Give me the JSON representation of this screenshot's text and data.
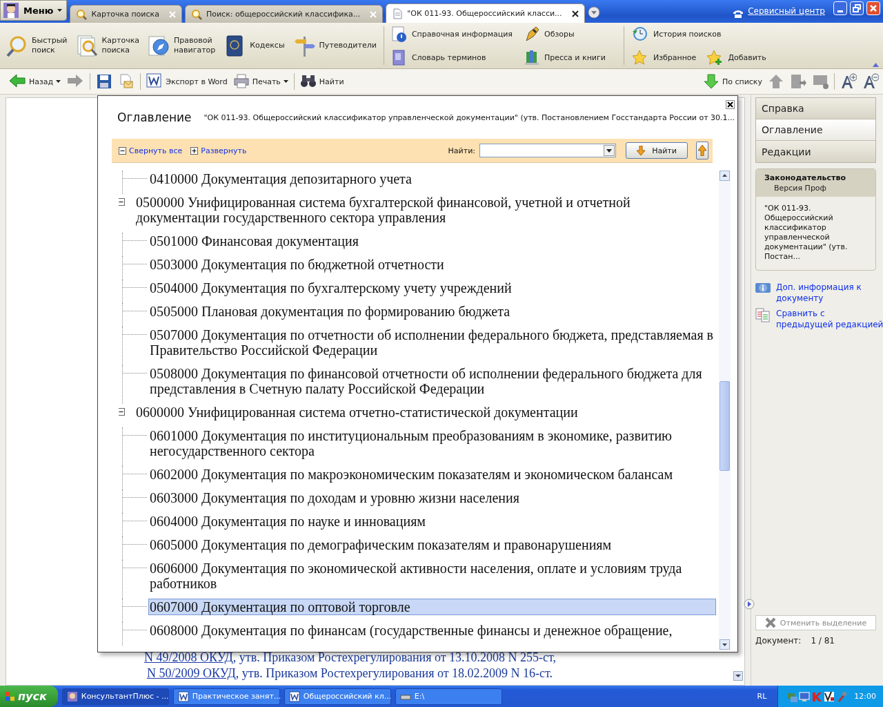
{
  "app": {
    "menu_label": "Меню",
    "service_link": "Сервисный центр"
  },
  "tabs": [
    {
      "label": "Карточка поиска",
      "selected": false
    },
    {
      "label": "Поиск: общероссийский классифика...",
      "selected": false
    },
    {
      "label": "\"ОК 011-93. Общероссийский класси...",
      "selected": true
    }
  ],
  "ribbon": {
    "large": [
      {
        "lines": [
          "Быстрый",
          "поиск"
        ]
      },
      {
        "lines": [
          "Карточка",
          "поиска"
        ]
      },
      {
        "lines": [
          "Правовой",
          "навигатор"
        ]
      },
      {
        "lines": [
          "Кодексы"
        ]
      },
      {
        "lines": [
          "Путеводители"
        ]
      }
    ],
    "reference": [
      [
        "Справочная информация",
        "Словарь терминов"
      ],
      [
        "Обзоры",
        "Пресса и книги"
      ]
    ],
    "history": [
      [
        "История поисков"
      ],
      [
        "Избранное",
        "Добавить"
      ]
    ]
  },
  "toolbar": {
    "left": [
      {
        "label": "Назад",
        "dropdown": true
      },
      {
        "label": "Экспорт в Word",
        "dropdown": false
      },
      {
        "label": "Печать",
        "dropdown": true
      },
      {
        "label": "Найти",
        "dropdown": false
      }
    ],
    "right": [
      {
        "label": "По списку"
      }
    ]
  },
  "document": {
    "lines": [
      {
        "link": "N 49/2008 ОКУД",
        "text": ", утв. Приказом Ростехрегулирования от 13.10.2008 N 255-ст,"
      },
      {
        "link": "N 50/2009 ОКУД",
        "text": ", утв. Приказом Ростехрегулирования от 18.02.2009 N 16-ст."
      }
    ]
  },
  "dialog": {
    "title": "Оглавление",
    "subtitle": "\"ОК 011-93. Общероссийский классификатор управленческой документации\" (утв. Постановлением Госстандарта России от 30.1...",
    "collapse_all": "Свернуть все",
    "expand_all": "Развернуть",
    "find_label": "Найти:",
    "find_button": "Найти",
    "tree": [
      {
        "kind": "leaf",
        "text": "0410000 Документация депозитарного учета",
        "selected": false
      },
      {
        "kind": "group",
        "text": "0500000 Унифицированная система бухгалтерской финансовой, учетной и отчетной документации государственного сектора управления",
        "expanded": true,
        "selected": false,
        "children": [
          {
            "kind": "leaf",
            "text": "0501000 Финансовая документация",
            "selected": false
          },
          {
            "kind": "leaf",
            "text": "0503000 Документация по бюджетной отчетности",
            "selected": false
          },
          {
            "kind": "leaf",
            "text": "0504000 Документация по бухгалтерскому учету учреждений",
            "selected": false
          },
          {
            "kind": "leaf",
            "text": "0505000 Плановая документация по формированию бюджета",
            "selected": false
          },
          {
            "kind": "leaf",
            "text": "0507000 Документация по отчетности об исполнении федерального бюджета, представляемая в Правительство Российской Федерации",
            "selected": false
          },
          {
            "kind": "leaf",
            "text": "0508000 Документация по финансовой отчетности об исполнении федерального бюджета для представления в Счетную палату Российской Федерации",
            "selected": false
          }
        ]
      },
      {
        "kind": "group",
        "text": "0600000 Унифицированная система отчетно-статистической документации",
        "expanded": true,
        "selected": false,
        "children": [
          {
            "kind": "leaf",
            "text": "0601000 Документация по институциональным преобразованиям в экономике, развитию негосударственного сектора",
            "selected": false
          },
          {
            "kind": "leaf",
            "text": "0602000 Документация по макроэкономическим показателям и экономическом балансам",
            "selected": false
          },
          {
            "kind": "leaf",
            "text": "0603000 Документация по доходам и уровню жизни населения",
            "selected": false
          },
          {
            "kind": "leaf",
            "text": "0604000 Документация по науке и инновациям",
            "selected": false
          },
          {
            "kind": "leaf",
            "text": "0605000 Документация по демографическим показателям и правонарушениям",
            "selected": false
          },
          {
            "kind": "leaf",
            "text": "0606000 Документация по экономической активности населения, оплате и условиям труда работников",
            "selected": false
          },
          {
            "kind": "leaf",
            "text": "0607000 Документация по оптовой торговле",
            "selected": true
          },
          {
            "kind": "leaf",
            "text": "0608000 Документация по финансам (государственные финансы и денежное обращение,",
            "selected": false
          }
        ]
      }
    ]
  },
  "side_panel": {
    "nav": [
      {
        "label": "Справка",
        "selected": false
      },
      {
        "label": "Оглавление",
        "selected": true
      },
      {
        "label": "Редакции",
        "selected": false
      }
    ],
    "info_card": {
      "title": "Законодательство",
      "subtitle": "Версия Проф",
      "text": "\"ОК 011-93. Общероссийский классификатор управленческой документации\" (утв. Постан..."
    },
    "links": [
      [
        "Доп. информация к",
        "документу"
      ],
      [
        "Сравнить с",
        "предыдущей редакцией"
      ]
    ],
    "clear_button": {
      "label": "Отменить выделение",
      "disabled": true
    },
    "doc_label": "Документ:",
    "doc_counter": "1 / 81"
  },
  "taskbar": {
    "start": "пуск",
    "tasks": [
      {
        "label": "КонсультантПлюс - ...",
        "selected": true
      },
      {
        "label": "Практическое занят...",
        "selected": false
      },
      {
        "label": "Общероссийский кл...",
        "selected": false
      },
      {
        "label": "E:\\",
        "selected": false
      }
    ],
    "lang": "RL",
    "clock": "12:00"
  }
}
